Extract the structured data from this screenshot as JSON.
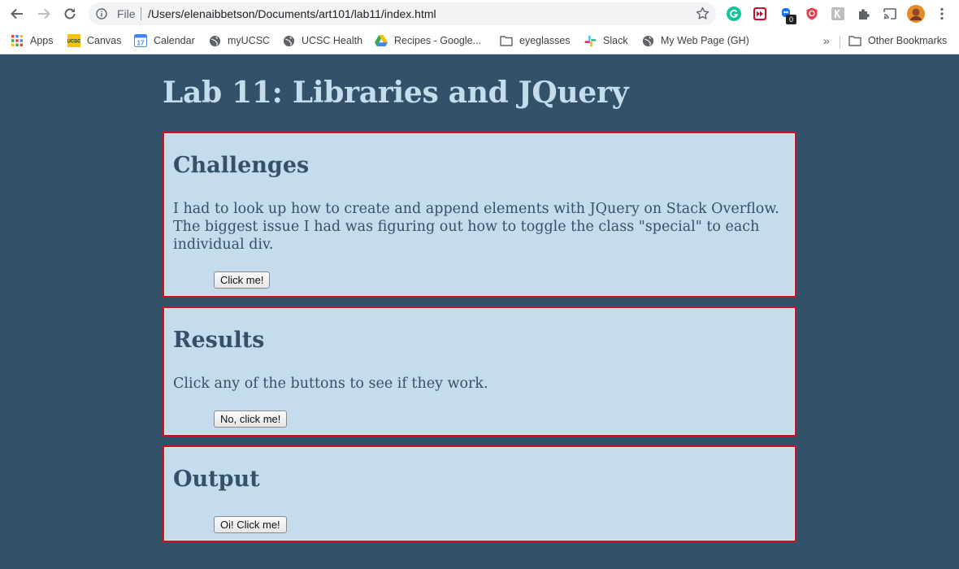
{
  "browser": {
    "address": {
      "scheme": "File",
      "url": "/Users/elenaibbetson/Documents/art101/lab11/index.html"
    },
    "extension_badge": "0",
    "bookmarks": [
      {
        "label": "Apps",
        "icon": "apps-grid-icon"
      },
      {
        "label": "Canvas",
        "icon": "ucsc-canvas-icon"
      },
      {
        "label": "Calendar",
        "icon": "calendar-icon"
      },
      {
        "label": "myUCSC",
        "icon": "globe-icon"
      },
      {
        "label": "UCSC Health",
        "icon": "globe-icon"
      },
      {
        "label": "Recipes - Google...",
        "icon": "google-drive-icon"
      },
      {
        "label": "eyeglasses",
        "icon": "folder-icon"
      },
      {
        "label": "Slack",
        "icon": "slack-icon"
      },
      {
        "label": "My Web Page (GH)",
        "icon": "globe-icon"
      }
    ],
    "other_bookmarks": "Other Bookmarks",
    "chevron": "»"
  },
  "page": {
    "title": "Lab 11: Libraries and JQuery",
    "sections": [
      {
        "heading": "Challenges",
        "text": "I had to look up how to create and append elements with JQuery on Stack Overflow. The biggest issue I had was figuring out how to toggle the class \"special\" to each individual div.",
        "button": "Click me!"
      },
      {
        "heading": "Results",
        "text": "Click any of the buttons to see if they work.",
        "button": "No, click me!"
      },
      {
        "heading": "Output",
        "button": "Oi! Click me!"
      }
    ]
  },
  "colors": {
    "page_background": "#33526a",
    "card_background": "#c4dcec",
    "card_border": "#d40f1f",
    "heading_text": "#33526a",
    "title_text": "#c4dcec"
  }
}
